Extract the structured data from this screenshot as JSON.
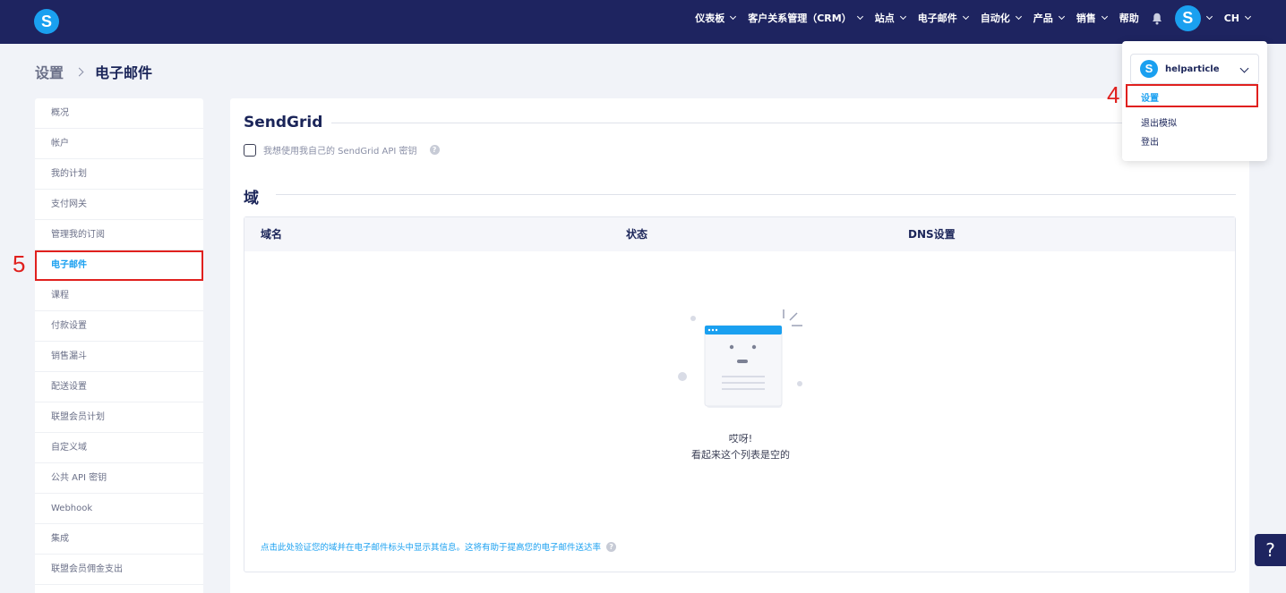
{
  "topnav": {
    "logo_letter": "S",
    "items": [
      "仪表板",
      "客户关系管理（CRM）",
      "站点",
      "电子邮件",
      "自动化",
      "产品",
      "销售",
      "帮助"
    ],
    "avatar_letter": "S",
    "language": "CH"
  },
  "breadcrumb": {
    "parent": "设置",
    "current": "电子邮件"
  },
  "sidebar": {
    "items": [
      "概况",
      "帐户",
      "我的计划",
      "支付网关",
      "管理我的订阅",
      "电子邮件",
      "课程",
      "付款设置",
      "销售漏斗",
      "配送设置",
      "联盟会员计划",
      "自定义域",
      "公共 API 密钥",
      "Webhook",
      "集成",
      "联盟会员佣金支出"
    ],
    "active": "电子邮件"
  },
  "annotations": {
    "sidebar_step": "5",
    "dropdown_step": "4"
  },
  "main": {
    "sendgrid_title": "SendGrid",
    "sendgrid_checkbox_label": "我想使用我自己的 SendGrid API 密钥",
    "domain_title": "域",
    "table_headers": [
      "域名",
      "状态",
      "DNS设置"
    ],
    "empty_line1": "哎呀!",
    "empty_line2": "看起来这个列表是空的",
    "verify_link": "点击此处验证您的域并在电子邮件标头中显示其信息。这将有助于提高您的电子邮件送达率"
  },
  "dropdown": {
    "account_name": "helparticle",
    "account_logo_letter": "S",
    "items": [
      "设置",
      "退出模拟",
      "登出"
    ]
  },
  "help_button": "?",
  "colors": {
    "nav_bg": "#1e2460",
    "accent": "#1aa0f0",
    "highlight": "#e0201e"
  }
}
